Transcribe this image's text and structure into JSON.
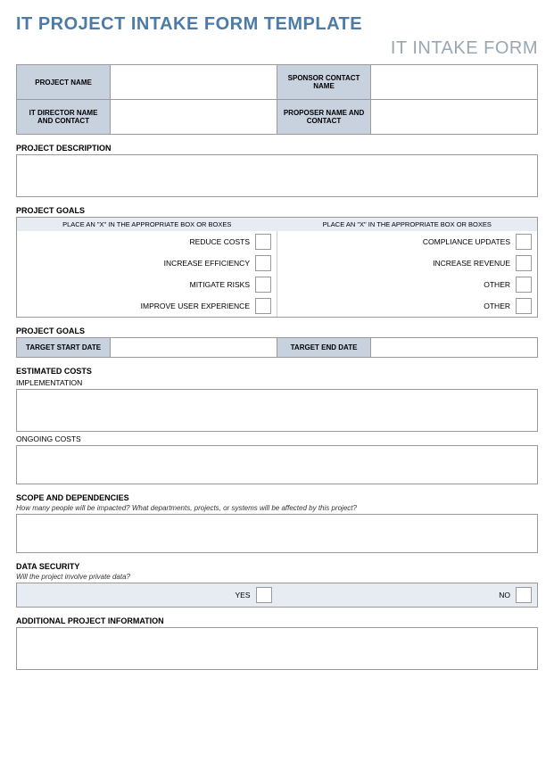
{
  "header": {
    "title": "IT PROJECT INTAKE FORM TEMPLATE",
    "subtitle": "IT INTAKE FORM"
  },
  "info": {
    "project_name_label": "PROJECT NAME",
    "project_name_value": "",
    "sponsor_label": "SPONSOR CONTACT NAME",
    "sponsor_value": "",
    "director_label": "IT DIRECTOR NAME AND CONTACT",
    "director_value": "",
    "proposer_label": "PROPOSER NAME AND CONTACT",
    "proposer_value": ""
  },
  "description": {
    "heading": "PROJECT DESCRIPTION",
    "value": ""
  },
  "goals": {
    "heading": "PROJECT GOALS",
    "instruction_left": "PLACE AN \"X\" IN THE APPROPRIATE BOX OR BOXES",
    "instruction_right": "PLACE AN \"X\" IN THE APPROPRIATE BOX OR BOXES",
    "left": [
      {
        "label": "REDUCE COSTS",
        "checked": ""
      },
      {
        "label": "INCREASE EFFICIENCY",
        "checked": ""
      },
      {
        "label": "MITIGATE RISKS",
        "checked": ""
      },
      {
        "label": "IMPROVE USER EXPERIENCE",
        "checked": ""
      }
    ],
    "right": [
      {
        "label": "COMPLIANCE UPDATES",
        "checked": ""
      },
      {
        "label": "INCREASE REVENUE",
        "checked": ""
      },
      {
        "label": "OTHER",
        "checked": ""
      },
      {
        "label": "OTHER",
        "checked": ""
      }
    ]
  },
  "dates": {
    "heading": "PROJECT GOALS",
    "start_label": "TARGET START DATE",
    "start_value": "",
    "end_label": "TARGET END DATE",
    "end_value": ""
  },
  "costs": {
    "heading": "ESTIMATED COSTS",
    "implementation_label": "IMPLEMENTATION",
    "implementation_value": "",
    "ongoing_label": "ONGOING COSTS",
    "ongoing_value": ""
  },
  "scope": {
    "heading": "SCOPE AND DEPENDENCIES",
    "hint": "How many people will be impacted? What departments, projects, or systems will be affected by this project?",
    "value": ""
  },
  "security": {
    "heading": "DATA SECURITY",
    "hint": "Will the project involve private data?",
    "yes_label": "YES",
    "yes_value": "",
    "no_label": "NO",
    "no_value": ""
  },
  "additional": {
    "heading": "ADDITIONAL PROJECT INFORMATION",
    "value": ""
  }
}
